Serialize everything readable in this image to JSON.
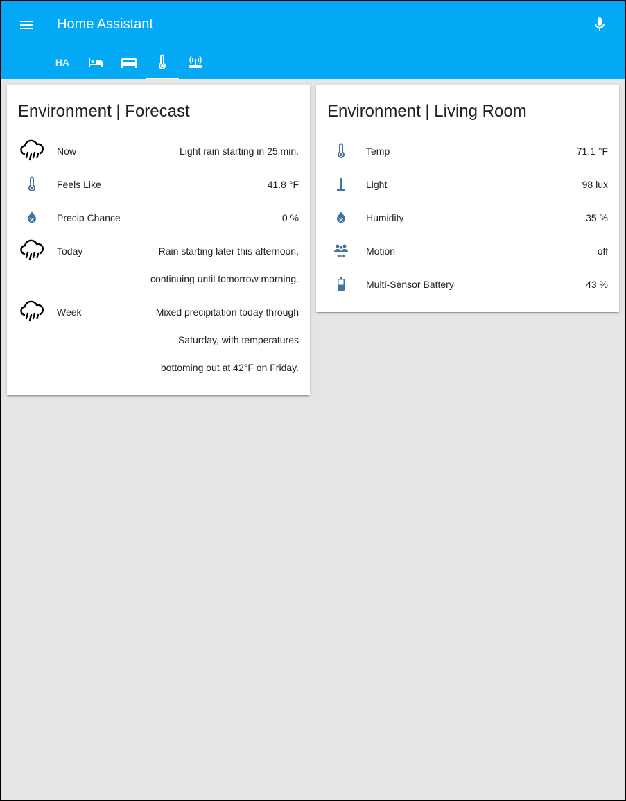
{
  "header": {
    "title": "Home Assistant",
    "tabs": [
      {
        "label": "HA",
        "icon": "text"
      },
      {
        "label": "",
        "icon": "bed-icon"
      },
      {
        "label": "",
        "icon": "sofa-icon"
      },
      {
        "label": "",
        "icon": "thermometer-icon"
      },
      {
        "label": "",
        "icon": "router-wireless-icon"
      }
    ],
    "selected_tab_index": 3
  },
  "forecast_card": {
    "title": "Environment | Forecast",
    "rows": [
      {
        "icon": "rain-cloud-icon",
        "label": "Now",
        "value_lines": [
          "Light rain starting in 25 min."
        ]
      },
      {
        "icon": "thermometer-icon",
        "label": "Feels Like",
        "value_lines": [
          "41.8 °F"
        ]
      },
      {
        "icon": "humidity-percent-icon",
        "label": "Precip Chance",
        "value_lines": [
          "0 %"
        ]
      },
      {
        "icon": "rain-cloud-icon",
        "label": "Today",
        "value_lines": [
          "Rain starting later this afternoon,",
          "continuing until tomorrow morning."
        ]
      },
      {
        "icon": "rain-cloud-icon",
        "label": "Week",
        "value_lines": [
          "Mixed precipitation today through",
          "Saturday, with temperatures",
          "bottoming out at 42°F on Friday."
        ]
      }
    ]
  },
  "living_room_card": {
    "title": "Environment | Living Room",
    "rows": [
      {
        "icon": "thermometer-icon",
        "label": "Temp",
        "value": "71.1 °F"
      },
      {
        "icon": "candle-light-icon",
        "label": "Light",
        "value": "98 lux"
      },
      {
        "icon": "humidity-percent-icon",
        "label": "Humidity",
        "value": "35 %"
      },
      {
        "icon": "motion-people-icon",
        "label": "Motion",
        "value": "off"
      },
      {
        "icon": "battery-icon",
        "label": "Multi-Sensor Battery",
        "value": "43 %"
      }
    ]
  },
  "colors": {
    "toolbar": "#03a9f4",
    "state_icon": "#44739e",
    "background": "#e5e5e5"
  }
}
